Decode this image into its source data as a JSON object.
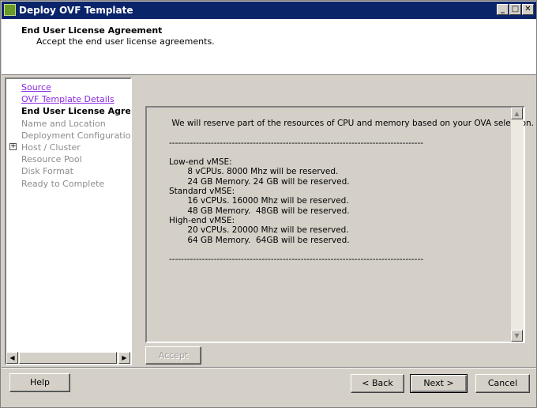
{
  "window": {
    "title": "Deploy OVF Template",
    "controls": [
      "minimize",
      "maximize",
      "close"
    ]
  },
  "header": {
    "title": "End User License Agreement",
    "subtitle": "Accept the end user license agreements."
  },
  "steps": [
    {
      "label": "Source",
      "state": "done"
    },
    {
      "label": "OVF Template Details",
      "state": "done"
    },
    {
      "label": "End User License Agreement",
      "state": "current"
    },
    {
      "label": "Name and Location",
      "state": "todo"
    },
    {
      "label": "Deployment Configuration",
      "state": "todo"
    },
    {
      "label": "Host / Cluster",
      "state": "todo",
      "expandable": true
    },
    {
      "label": "Resource Pool",
      "state": "todo"
    },
    {
      "label": "Disk Format",
      "state": "todo"
    },
    {
      "label": "Ready to Complete",
      "state": "todo"
    }
  ],
  "eula": {
    "lines": [
      " We will reserve part of the resources of CPU and memory based on your OVA selection.",
      "",
      "-------------------------------------------------------------------------------------",
      "",
      "Low-end vMSE:",
      "       8 vCPUs. 8000 Mhz will be reserved.",
      "       24 GB Memory. 24 GB will be reserved.",
      "Standard vMSE:",
      "       16 vCPUs. 16000 Mhz will be reserved.",
      "       48 GB Memory.  48GB will be reserved.",
      "High-end vMSE:",
      "       20 vCPUs. 20000 Mhz will be reserved.",
      "       64 GB Memory.  64GB will be reserved.",
      "",
      "-------------------------------------------------------------------------------------"
    ]
  },
  "buttons": {
    "accept": "Accept",
    "help": "Help",
    "back": "< Back",
    "next": "Next >",
    "cancel": "Cancel"
  }
}
